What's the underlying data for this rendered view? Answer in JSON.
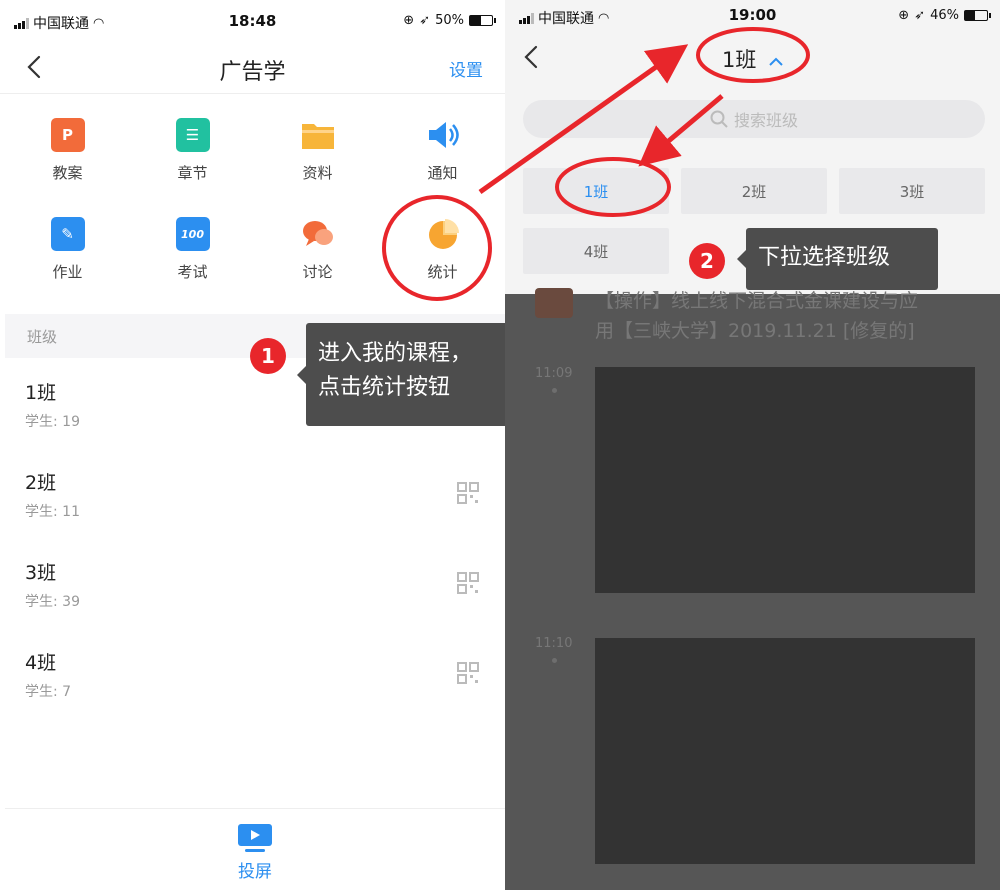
{
  "colors": {
    "accent": "#2c8ff0",
    "annotation_red": "#e8262b",
    "tip_bg": "#4d4d4d",
    "overlay": "#565656"
  },
  "left": {
    "status": {
      "carrier": "中国联通",
      "time": "18:48",
      "battery": "50%",
      "battery_level": 0.5
    },
    "nav": {
      "title": "广告学",
      "settings": "设置"
    },
    "features": [
      {
        "label": "教案",
        "icon": "ppt-icon",
        "color": "#f26b3a",
        "glyph": "P"
      },
      {
        "label": "章节",
        "icon": "list-icon",
        "color": "#21c1a0",
        "glyph": "☰"
      },
      {
        "label": "资料",
        "icon": "folder-icon",
        "color": "#f7b53a",
        "glyph": ""
      },
      {
        "label": "通知",
        "icon": "speaker-icon",
        "color": "#2c8ff0",
        "glyph": "◀"
      },
      {
        "label": "作业",
        "icon": "homework-icon",
        "color": "#2c8ff0",
        "glyph": "✎"
      },
      {
        "label": "考试",
        "icon": "exam-icon",
        "color": "#2c8ff0",
        "glyph": "100"
      },
      {
        "label": "讨论",
        "icon": "discussion-icon",
        "color": "#f26b3a",
        "glyph": ""
      },
      {
        "label": "统计",
        "icon": "pie-chart-icon",
        "color": "#f7a531",
        "glyph": ""
      }
    ],
    "section_title": "班级",
    "classes": [
      {
        "name": "1班",
        "count": "学生: 19"
      },
      {
        "name": "2班",
        "count": "学生: 11"
      },
      {
        "name": "3班",
        "count": "学生: 39"
      },
      {
        "name": "4班",
        "count": "学生: 7"
      }
    ],
    "bottom": {
      "label": "投屏"
    },
    "annotation": {
      "step": "1",
      "line1": "进入我的课程，",
      "line2": "点击统计按钮"
    }
  },
  "right": {
    "status": {
      "carrier": "中国联通",
      "time": "19:00",
      "battery": "46%",
      "battery_level": 0.46
    },
    "nav": {
      "title": "1班"
    },
    "search_placeholder": "搜索班级",
    "chips": [
      "1班",
      "2班",
      "3班",
      "4班"
    ],
    "selected_chip": "1班",
    "annotation": {
      "step": "2",
      "text": "下拉选择班级"
    },
    "faded_item": {
      "line1": "【操作】线上线下混合式金课建设与应",
      "line2": "用【三峡大学】2019.11.21 [修复的]"
    },
    "timestamps": [
      "11:09",
      "11:10"
    ]
  }
}
